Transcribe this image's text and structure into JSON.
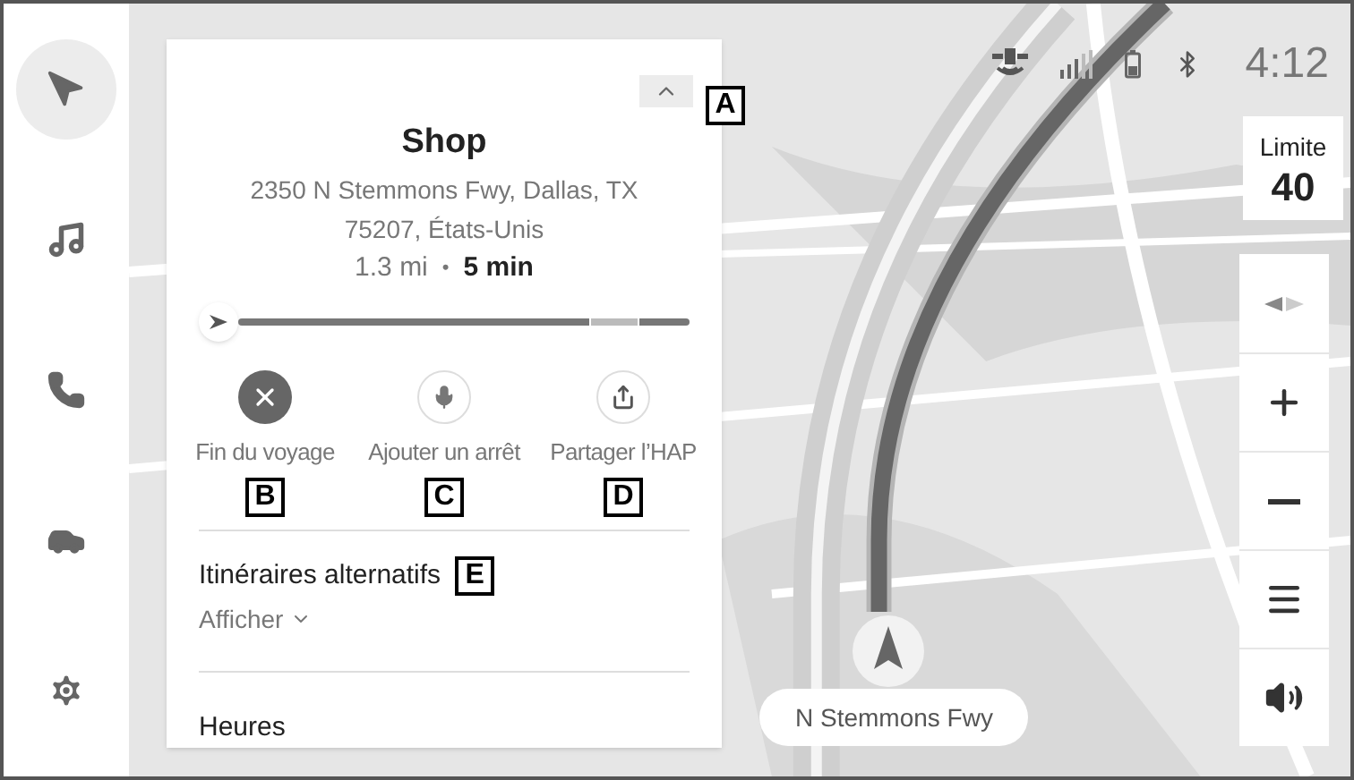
{
  "sidebar": {
    "items": [
      {
        "kind": "navigation",
        "selected": true
      },
      {
        "kind": "music",
        "selected": false
      },
      {
        "kind": "phone",
        "selected": false
      },
      {
        "kind": "vehicle",
        "selected": false
      },
      {
        "kind": "settings",
        "selected": false
      }
    ]
  },
  "destination_panel": {
    "collapse_callout": "A",
    "title": "Shop",
    "address_lines": [
      "2350 N Stemmons Fwy, Dallas, TX",
      "75207, États-Unis"
    ],
    "distance": "1.3 mi",
    "separator": "•",
    "duration": "5 min",
    "actions": [
      {
        "kind": "end",
        "label": "Fin du voyage",
        "callout": "B"
      },
      {
        "kind": "voice",
        "label": "Ajouter un arrêt",
        "callout": "C"
      },
      {
        "kind": "share",
        "label": "Partager l’HAP",
        "callout": "D"
      }
    ],
    "alternatives": {
      "title": "Itinéraires alternatifs",
      "callout": "E",
      "toggle": "Afficher",
      "expanded": false
    },
    "hours": {
      "title": "Heures"
    }
  },
  "status_bar": {
    "time": "4:12"
  },
  "speed_limit": {
    "label": "Limite",
    "value": "40"
  },
  "map_controls": [
    {
      "kind": "compass"
    },
    {
      "kind": "zoom_in"
    },
    {
      "kind": "zoom_out"
    },
    {
      "kind": "menu"
    },
    {
      "kind": "volume"
    }
  ],
  "road_name": "N Stemmons Fwy"
}
